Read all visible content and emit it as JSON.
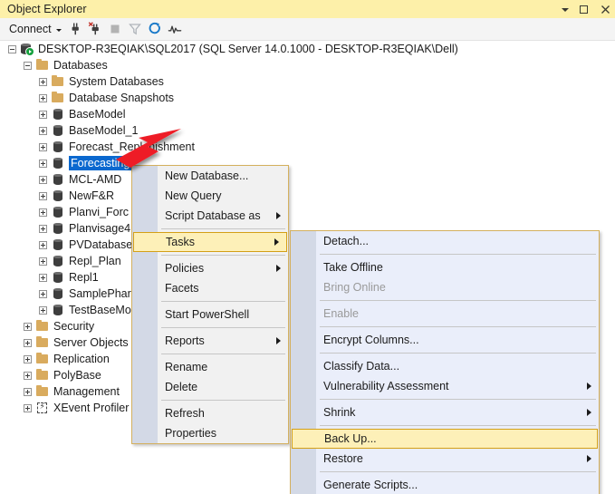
{
  "window": {
    "title": "Object Explorer",
    "buttons": [
      {
        "name": "window-menu-caret",
        "label": "▾"
      },
      {
        "name": "maximize-button",
        "label": "□"
      },
      {
        "name": "close-button",
        "label": "×"
      }
    ]
  },
  "toolbar": {
    "connect_label": "Connect",
    "icons": [
      {
        "name": "connect-object-explorer-icon",
        "glyph": "⑂",
        "enabled": true
      },
      {
        "name": "disconnect-object-explorer-icon",
        "glyph": "⑂",
        "enabled": true
      },
      {
        "name": "stop-icon",
        "glyph": "■",
        "enabled": false
      },
      {
        "name": "filter-icon",
        "glyph": "▽",
        "enabled": false
      },
      {
        "name": "refresh-icon",
        "glyph": "↻",
        "enabled": true
      },
      {
        "name": "activity-monitor-icon",
        "glyph": "∿",
        "enabled": true
      }
    ]
  },
  "tree": {
    "nodes": [
      {
        "label": "DESKTOP-R3EQIAK\\SQL2017 (SQL Server 14.0.1000 - DESKTOP-R3EQIAK\\Dell)",
        "indent": 0,
        "expander": "minus",
        "icon": "server",
        "selected": false
      },
      {
        "label": "Databases",
        "indent": 1,
        "expander": "minus",
        "icon": "folder",
        "selected": false
      },
      {
        "label": "System Databases",
        "indent": 2,
        "expander": "plus",
        "icon": "folder",
        "selected": false
      },
      {
        "label": "Database Snapshots",
        "indent": 2,
        "expander": "plus",
        "icon": "folder",
        "selected": false
      },
      {
        "label": "BaseModel",
        "indent": 2,
        "expander": "plus",
        "icon": "database",
        "selected": false
      },
      {
        "label": "BaseModel_1",
        "indent": 2,
        "expander": "plus",
        "icon": "database",
        "selected": false
      },
      {
        "label": "Forecast_Replenishment",
        "indent": 2,
        "expander": "plus",
        "icon": "database",
        "selected": false
      },
      {
        "label": "Forecasting",
        "indent": 2,
        "expander": "plus",
        "icon": "database",
        "selected": true
      },
      {
        "label": "MCL-AMD",
        "indent": 2,
        "expander": "plus",
        "icon": "database",
        "selected": false
      },
      {
        "label": "NewF&R",
        "indent": 2,
        "expander": "plus",
        "icon": "database",
        "selected": false
      },
      {
        "label": "Planvi_Forc",
        "indent": 2,
        "expander": "plus",
        "icon": "database",
        "selected": false
      },
      {
        "label": "Planvisage4",
        "indent": 2,
        "expander": "plus",
        "icon": "database",
        "selected": false
      },
      {
        "label": "PVDatabase",
        "indent": 2,
        "expander": "plus",
        "icon": "database",
        "selected": false
      },
      {
        "label": "Repl_Plan",
        "indent": 2,
        "expander": "plus",
        "icon": "database",
        "selected": false
      },
      {
        "label": "Repl1",
        "indent": 2,
        "expander": "plus",
        "icon": "database",
        "selected": false
      },
      {
        "label": "SamplePhar",
        "indent": 2,
        "expander": "plus",
        "icon": "database",
        "selected": false
      },
      {
        "label": "TestBaseMo",
        "indent": 2,
        "expander": "plus",
        "icon": "database",
        "selected": false
      },
      {
        "label": "Security",
        "indent": 1,
        "expander": "plus",
        "icon": "folder",
        "selected": false
      },
      {
        "label": "Server Objects",
        "indent": 1,
        "expander": "plus",
        "icon": "folder",
        "selected": false
      },
      {
        "label": "Replication",
        "indent": 1,
        "expander": "plus",
        "icon": "folder",
        "selected": false
      },
      {
        "label": "PolyBase",
        "indent": 1,
        "expander": "plus",
        "icon": "folder",
        "selected": false
      },
      {
        "label": "Management",
        "indent": 1,
        "expander": "plus",
        "icon": "folder",
        "selected": false
      },
      {
        "label": "XEvent Profiler",
        "indent": 1,
        "expander": "plus",
        "icon": "xevent",
        "selected": false
      }
    ]
  },
  "context_menu": {
    "items": [
      {
        "type": "item",
        "label": "New Database...",
        "submenu": false,
        "highlighted": false,
        "disabled": false
      },
      {
        "type": "item",
        "label": "New Query",
        "submenu": false,
        "highlighted": false,
        "disabled": false
      },
      {
        "type": "item",
        "label": "Script Database as",
        "submenu": true,
        "highlighted": false,
        "disabled": false
      },
      {
        "type": "separator"
      },
      {
        "type": "item",
        "label": "Tasks",
        "submenu": true,
        "highlighted": true,
        "disabled": false
      },
      {
        "type": "separator"
      },
      {
        "type": "item",
        "label": "Policies",
        "submenu": true,
        "highlighted": false,
        "disabled": false
      },
      {
        "type": "item",
        "label": "Facets",
        "submenu": false,
        "highlighted": false,
        "disabled": false
      },
      {
        "type": "separator"
      },
      {
        "type": "item",
        "label": "Start PowerShell",
        "submenu": false,
        "highlighted": false,
        "disabled": false
      },
      {
        "type": "separator"
      },
      {
        "type": "item",
        "label": "Reports",
        "submenu": true,
        "highlighted": false,
        "disabled": false
      },
      {
        "type": "separator"
      },
      {
        "type": "item",
        "label": "Rename",
        "submenu": false,
        "highlighted": false,
        "disabled": false
      },
      {
        "type": "item",
        "label": "Delete",
        "submenu": false,
        "highlighted": false,
        "disabled": false
      },
      {
        "type": "separator"
      },
      {
        "type": "item",
        "label": "Refresh",
        "submenu": false,
        "highlighted": false,
        "disabled": false
      },
      {
        "type": "item",
        "label": "Properties",
        "submenu": false,
        "highlighted": false,
        "disabled": false
      }
    ]
  },
  "tasks_submenu": {
    "items": [
      {
        "type": "item",
        "label": "Detach...",
        "submenu": false,
        "highlighted": false,
        "disabled": false
      },
      {
        "type": "separator"
      },
      {
        "type": "item",
        "label": "Take Offline",
        "submenu": false,
        "highlighted": false,
        "disabled": false
      },
      {
        "type": "item",
        "label": "Bring Online",
        "submenu": false,
        "highlighted": false,
        "disabled": true
      },
      {
        "type": "separator"
      },
      {
        "type": "item",
        "label": "Enable",
        "submenu": false,
        "highlighted": false,
        "disabled": true
      },
      {
        "type": "separator"
      },
      {
        "type": "item",
        "label": "Encrypt Columns...",
        "submenu": false,
        "highlighted": false,
        "disabled": false
      },
      {
        "type": "separator"
      },
      {
        "type": "item",
        "label": "Classify Data...",
        "submenu": false,
        "highlighted": false,
        "disabled": false
      },
      {
        "type": "item",
        "label": "Vulnerability Assessment",
        "submenu": true,
        "highlighted": false,
        "disabled": false
      },
      {
        "type": "separator"
      },
      {
        "type": "item",
        "label": "Shrink",
        "submenu": true,
        "highlighted": false,
        "disabled": false
      },
      {
        "type": "separator"
      },
      {
        "type": "item",
        "label": "Back Up...",
        "submenu": false,
        "highlighted": true,
        "disabled": false
      },
      {
        "type": "item",
        "label": "Restore",
        "submenu": true,
        "highlighted": false,
        "disabled": false
      },
      {
        "type": "separator"
      },
      {
        "type": "item",
        "label": "Generate Scripts...",
        "submenu": false,
        "highlighted": false,
        "disabled": false
      }
    ]
  },
  "annotation": {
    "arrow_color": "#ee1c25",
    "points_to": "Forecasting"
  },
  "colors": {
    "titlebar": "#fdf0a9",
    "selection": "#0a68cf",
    "menu_bg": "#f1f1f1",
    "submenu_bg": "#eaeefa",
    "menu_border": "#d4b05e",
    "highlight_bg": "#fdf0b8",
    "highlight_border": "#d4a017",
    "gutter": "#d3d9e6",
    "folder": "#d9ab5e",
    "database": "#3e3e3e"
  }
}
